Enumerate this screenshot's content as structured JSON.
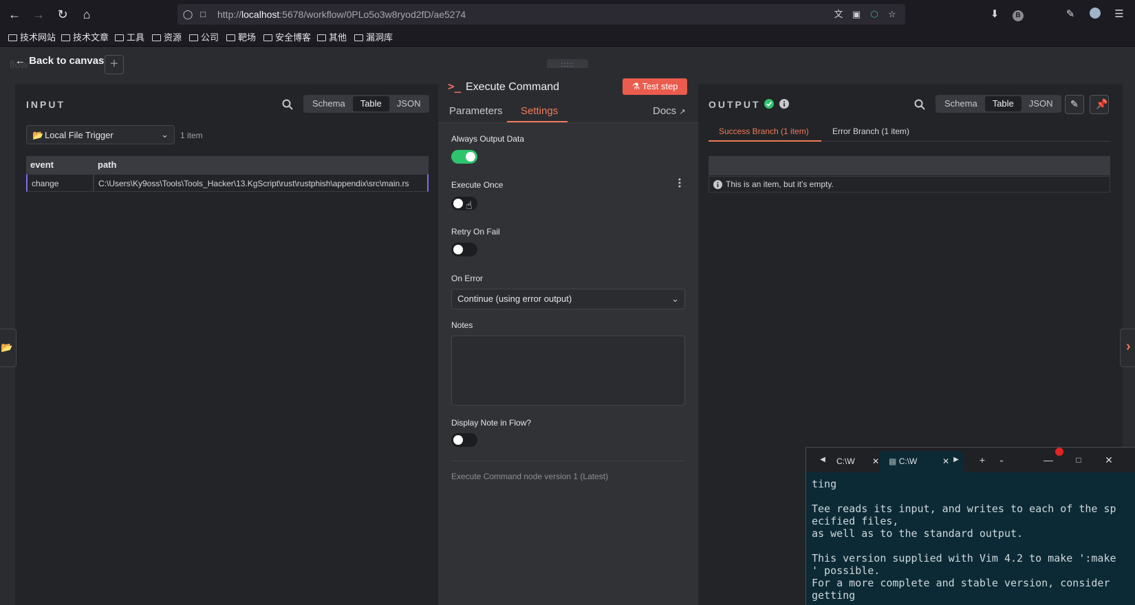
{
  "browser": {
    "url_prefix": "http://",
    "url_host": "localhost",
    "url_rest": ":5678/workflow/0PLo5o3w8ryod2fD/ae5274",
    "bookmarks": [
      "技术网站",
      "技术文章",
      "工具",
      "资源",
      "公司",
      "靶场",
      "安全博客",
      "其他",
      "漏洞库"
    ],
    "profile_letter": "B"
  },
  "app": {
    "back_label": "Back to canvas",
    "ghost_title": "flow"
  },
  "input": {
    "label": "INPUT",
    "views": [
      "Schema",
      "Table",
      "JSON"
    ],
    "active_view": "Table",
    "source_select": "Local File Trigger",
    "item_count": "1 item",
    "columns": [
      "event",
      "path"
    ],
    "row": [
      "change",
      "C:\\Users\\Ky9oss\\Tools\\Tools_Hacker\\13.KgScript\\rust\\rustphish\\appendix\\src\\main.rs"
    ]
  },
  "node": {
    "handle": ":::::",
    "title": "Execute Command",
    "test_label": "Test step",
    "tabs": [
      "Parameters",
      "Settings"
    ],
    "active_tab": "Settings",
    "docs_label": "Docs",
    "fields": {
      "always_output": "Always Output Data",
      "execute_once": "Execute Once",
      "retry_on_fail": "Retry On Fail",
      "on_error": "On Error",
      "on_error_value": "Continue (using error output)",
      "notes": "Notes",
      "display_note": "Display Note in Flow?"
    },
    "toggles": {
      "always_output": true,
      "execute_once": false,
      "retry_on_fail": false,
      "display_note": false
    },
    "version_note": "Execute Command node version 1 (Latest)"
  },
  "output": {
    "label": "OUTPUT",
    "views": [
      "Schema",
      "Table",
      "JSON"
    ],
    "active_view": "Table",
    "branches": [
      "Success Branch (1 item)",
      "Error Branch (1 item)"
    ],
    "empty_message": "This is an item, but it's empty."
  },
  "terminal": {
    "tabs": [
      "C:\\W",
      "C:\\W"
    ],
    "lines": "ting\n\nTee reads its input, and writes to each of the sp\necified files,\nas well as to the standard output.\n\nThis version supplied with Vim 4.2 to make ':make\n' possible.\nFor a more complete and stable version, consider\ngetting"
  },
  "colors": {
    "accent": "#f07a5c",
    "success": "#2ec36d",
    "test_button": "#ea5c4d"
  }
}
